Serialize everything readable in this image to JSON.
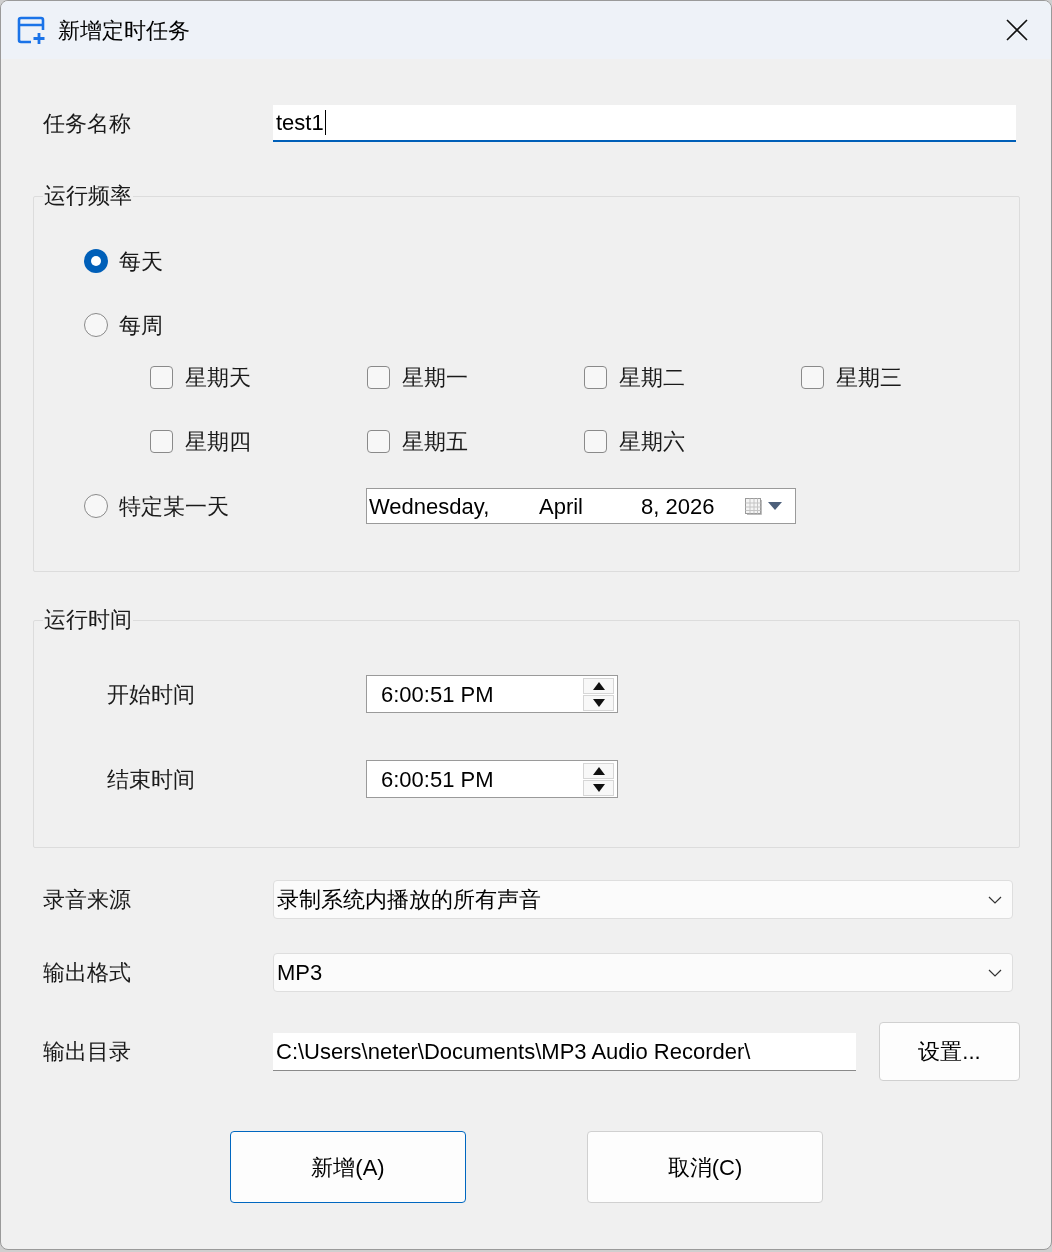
{
  "window": {
    "title": "新增定时任务"
  },
  "task_name": {
    "label": "任务名称",
    "value": "test1",
    "focused": true
  },
  "frequency": {
    "title": "运行频率",
    "options": [
      {
        "kind": "daily",
        "label": "每天",
        "selected": true
      },
      {
        "kind": "weekly",
        "label": "每周",
        "selected": false
      },
      {
        "kind": "date",
        "label": "特定某一天",
        "selected": false
      }
    ],
    "weekdays": [
      {
        "label": "星期天",
        "checked": false
      },
      {
        "label": "星期一",
        "checked": false
      },
      {
        "label": "星期二",
        "checked": false
      },
      {
        "label": "星期三",
        "checked": false
      },
      {
        "label": "星期四",
        "checked": false
      },
      {
        "label": "星期五",
        "checked": false
      },
      {
        "label": "星期六",
        "checked": false
      }
    ],
    "date": {
      "weekday": "Wednesday,",
      "month": "April",
      "day_year": "8, 2026"
    }
  },
  "run_time": {
    "title": "运行时间",
    "fields": [
      {
        "label": "开始时间",
        "value": "6:00:51 PM"
      },
      {
        "label": "结束时间",
        "value": "6:00:51 PM"
      }
    ]
  },
  "source": {
    "label": "录音来源",
    "value": "录制系统内播放的所有声音"
  },
  "format": {
    "label": "输出格式",
    "value": "MP3"
  },
  "output_dir": {
    "label": "输出目录",
    "value": "C:\\Users\\neter\\Documents\\MP3 Audio Recorder\\",
    "button": "设置..."
  },
  "buttons": [
    {
      "label": "新增(A)",
      "default": true
    },
    {
      "label": "取消(C)",
      "default": false
    }
  ]
}
